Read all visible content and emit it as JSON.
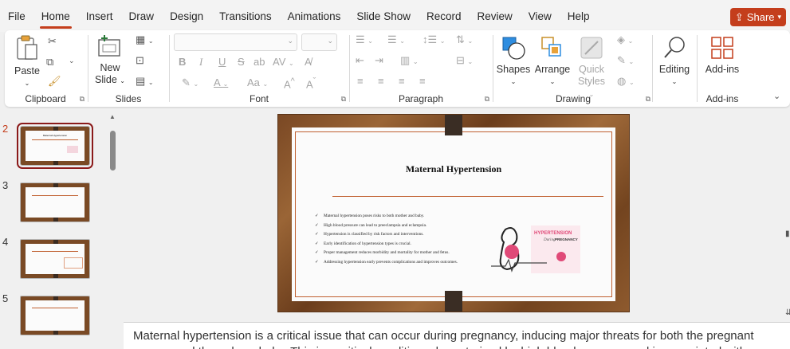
{
  "menu": {
    "items": [
      "File",
      "Home",
      "Insert",
      "Draw",
      "Design",
      "Transitions",
      "Animations",
      "Slide Show",
      "Record",
      "Review",
      "View",
      "Help"
    ],
    "active": "Home",
    "share_label": "Share",
    "accent": "#c43e1c"
  },
  "ribbon": {
    "clipboard": {
      "label": "Clipboard",
      "paste": "Paste"
    },
    "slides": {
      "label": "Slides",
      "new_slide_line1": "New",
      "new_slide_line2": "Slide"
    },
    "font": {
      "label": "Font",
      "bold": "B",
      "italic": "I",
      "underline": "U",
      "strike": "S",
      "size_case": "Aa"
    },
    "paragraph": {
      "label": "Paragraph"
    },
    "drawing": {
      "label": "Drawing",
      "shapes": "Shapes",
      "arrange": "Arrange",
      "quick_line1": "Quick",
      "quick_line2": "Styles"
    },
    "editing": {
      "label": "Editing"
    },
    "addins": {
      "label": "Add-ins",
      "button": "Add-ins"
    }
  },
  "thumbnails": [
    {
      "number": "2",
      "selected": true
    },
    {
      "number": "3",
      "selected": false
    },
    {
      "number": "4",
      "selected": false
    },
    {
      "number": "5",
      "selected": false
    }
  ],
  "slide": {
    "title": "Maternal Hypertension",
    "bullets": [
      "Maternal hypertension poses risks to both mother and baby.",
      "High blood pressure can lead to preeclampsia and eclampsia.",
      "Hypertension is classified by risk factors and interventions.",
      "Early identification of hypertension types is crucial.",
      "Proper management reduces morbidity and mortality for mother and fetus.",
      "Addressing hypertension early prevents complications and improves outcomes."
    ],
    "image_text": {
      "line1": "HYPERTENSION",
      "line2": "During",
      "line3": "PREGNANCY"
    }
  },
  "notes": {
    "text": "Maternal hypertension is a critical issue that can occur during pregnancy, inducing major threats for both the pregnant woman and the unborn baby. This is a critical condition, characterized by high blood pressure and is associated with"
  }
}
